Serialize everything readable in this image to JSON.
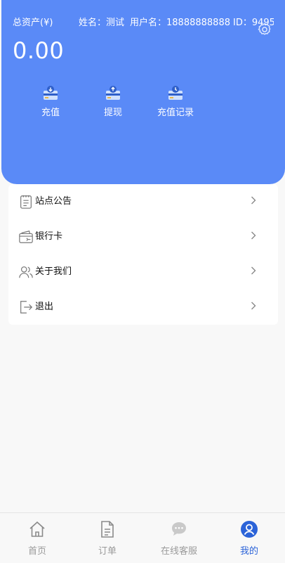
{
  "header": {
    "asset_label": "总资产(¥)",
    "name_text": "姓名：测试",
    "username_text": "用户名：18888888888",
    "id_text": "ID：9495",
    "balance": "0.00",
    "settings_icon": "gear-icon",
    "actions": [
      {
        "label": "充值",
        "icon": "deposit-icon"
      },
      {
        "label": "提现",
        "icon": "withdraw-icon"
      },
      {
        "label": "充值记录",
        "icon": "records-icon"
      }
    ]
  },
  "menu": {
    "items": [
      {
        "label": "站点公告",
        "icon": "notice-icon"
      },
      {
        "label": "银行卡",
        "icon": "bank-card-icon"
      },
      {
        "label": "关于我们",
        "icon": "users-icon"
      },
      {
        "label": "退出",
        "icon": "logout-icon"
      }
    ]
  },
  "tabbar": {
    "tabs": [
      {
        "label": "首页",
        "icon": "home-icon"
      },
      {
        "label": "订单",
        "icon": "order-icon"
      },
      {
        "label": "在线客服",
        "icon": "chat-icon"
      },
      {
        "label": "我的",
        "icon": "user-profile-icon",
        "active": true
      }
    ]
  },
  "colors": {
    "brand_blue": "#5a8af7",
    "active_tab": "#2b63d8",
    "inactive_tab": "#9a9a9a",
    "background": "#f8f8f8"
  }
}
